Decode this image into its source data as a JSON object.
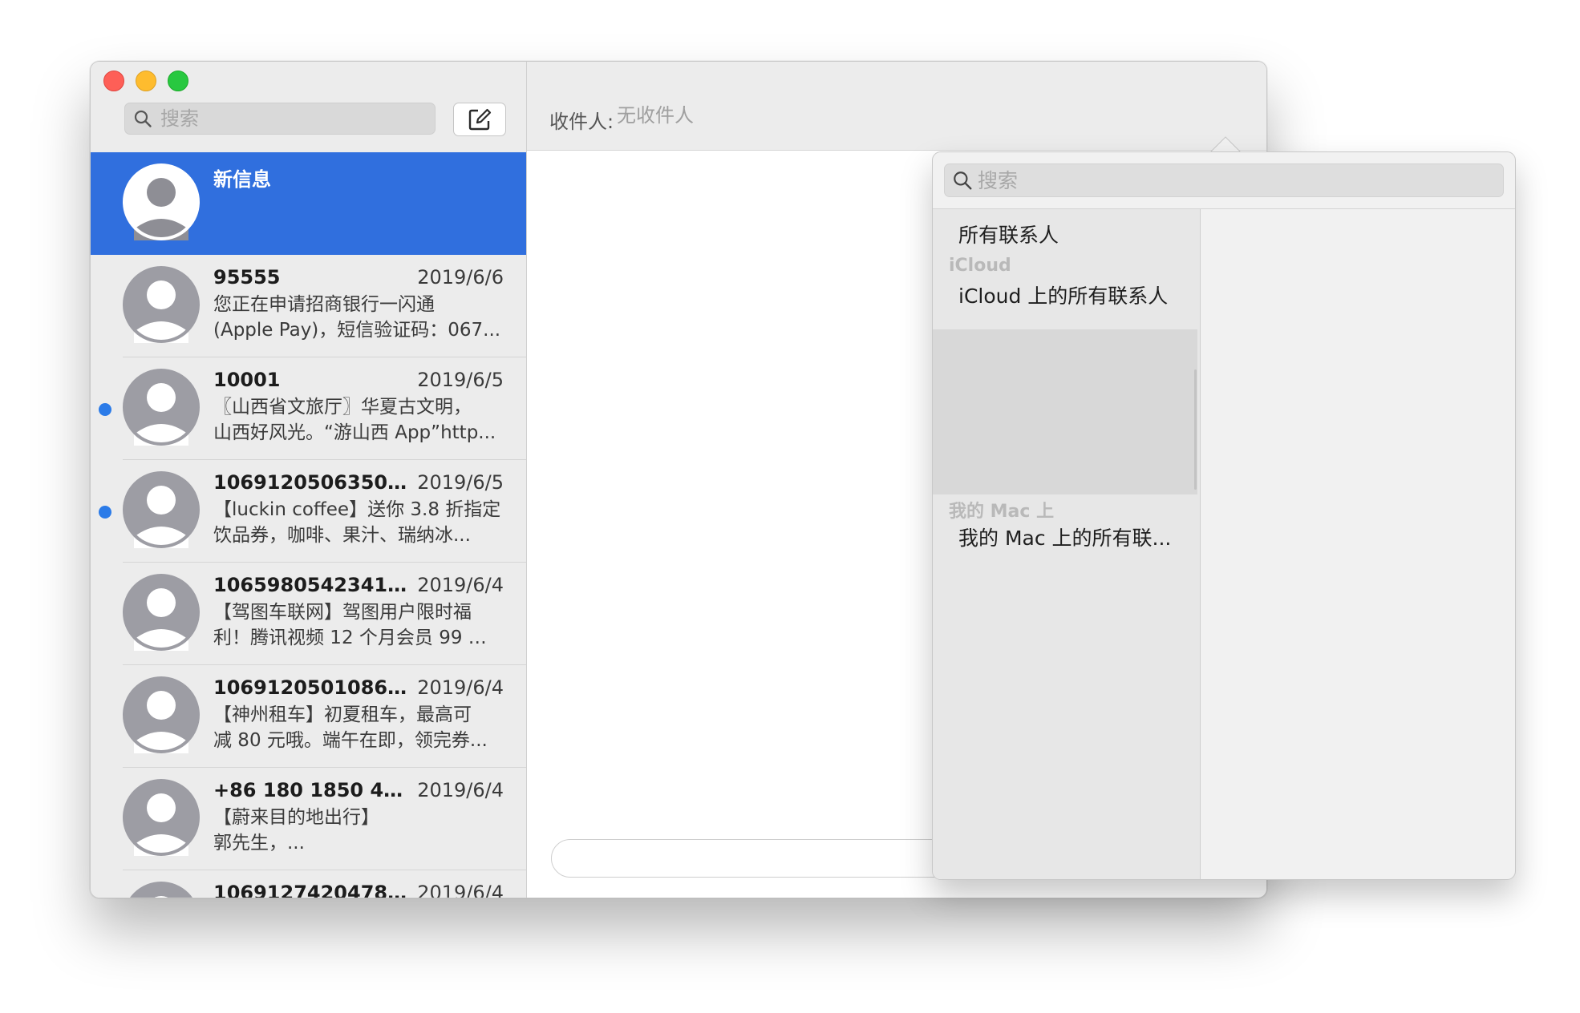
{
  "sidebar": {
    "search_placeholder": "搜索",
    "conversations": [
      {
        "name": "新信息",
        "date": "",
        "preview": [
          "",
          ""
        ],
        "selected": true,
        "unread": false
      },
      {
        "name": "95555",
        "date": "2019/6/6",
        "preview": [
          "您正在申请招商银行一闪通",
          "(Apple Pay)，短信验证码：067..."
        ],
        "unread": false
      },
      {
        "name": "10001",
        "date": "2019/6/5",
        "preview": [
          "〖山西省文旅厅〗华夏古文明，",
          "山西好风光。“游山西 App”http..."
        ],
        "unread": true
      },
      {
        "name": "10691205063507...",
        "date": "2019/6/5",
        "preview": [
          "【luckin coffee】送你 3.8 折指定",
          "饮品券，咖啡、果汁、瑞纳冰..."
        ],
        "unread": true
      },
      {
        "name": "10659805423417...",
        "date": "2019/6/4",
        "preview": [
          "【驾图车联网】驾图用户限时福",
          "利！腾讯视频 12 个月会员 99 元..."
        ],
        "unread": false
      },
      {
        "name": "10691205010868​1",
        "date": "2019/6/4",
        "preview": [
          "【神州租车】初夏租车，最高可",
          "减 80 元哦。端午在即，领完券..."
        ],
        "unread": false
      },
      {
        "name": "+86 180 1850 4101",
        "date": "2019/6/4",
        "preview": [
          "【蔚来目的地出行】",
          "郭先生，..."
        ],
        "unread": false
      },
      {
        "name": "10691274204787​0",
        "date": "2019/6/4",
        "preview": [
          "",
          ""
        ],
        "unread": false
      }
    ]
  },
  "header": {
    "to_label": "收件人:",
    "to_placeholder": "无收件人"
  },
  "popover": {
    "search_placeholder": "搜索",
    "all_contacts": "所有联系人",
    "icloud_header": "iCloud",
    "icloud_all": "iCloud 上的所有联系人",
    "mac_header": "我的 Mac 上",
    "mac_all": "我的 Mac 上的所有联..."
  },
  "colors": {
    "selection": "#306fde",
    "unread_dot": "#2b7be8",
    "add_icon": "#2b6fd6"
  }
}
